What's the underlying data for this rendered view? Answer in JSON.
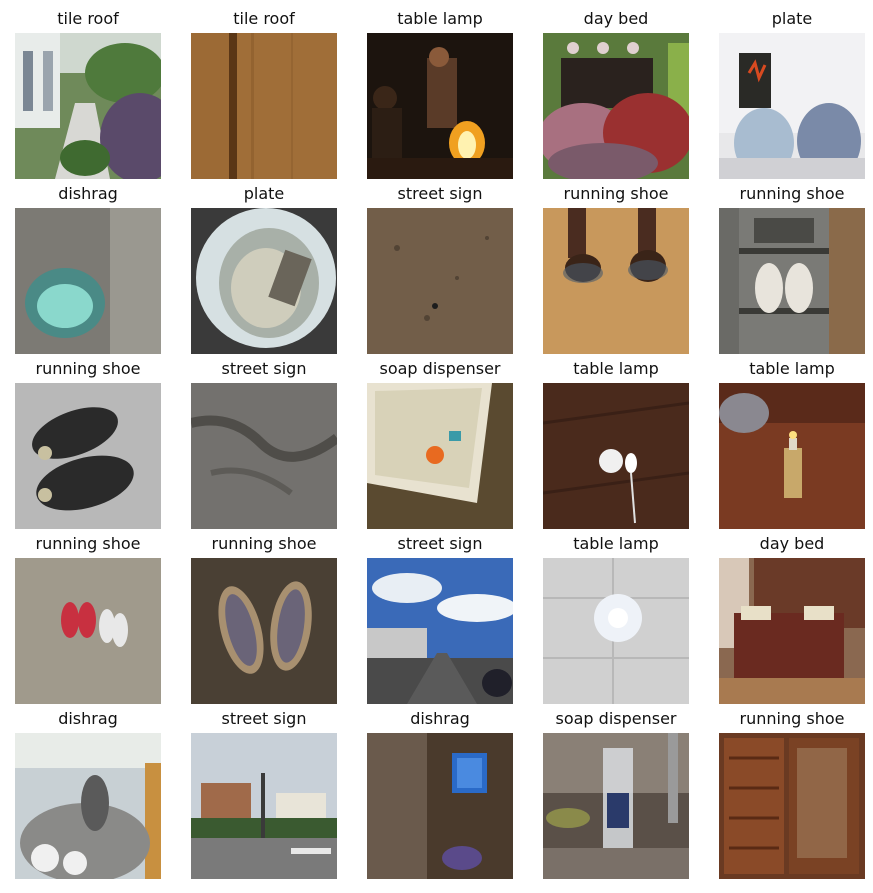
{
  "grid": {
    "rows": 5,
    "columns": 5,
    "items": [
      {
        "label": "tile roof",
        "scene": "garden"
      },
      {
        "label": "tile roof",
        "scene": "wood"
      },
      {
        "label": "table lamp",
        "scene": "fire"
      },
      {
        "label": "day bed",
        "scene": "messy-bed"
      },
      {
        "label": "plate",
        "scene": "plates"
      },
      {
        "label": "dishrag",
        "scene": "basin-cloth"
      },
      {
        "label": "plate",
        "scene": "bowl-food"
      },
      {
        "label": "street sign",
        "scene": "dirt"
      },
      {
        "label": "running shoe",
        "scene": "feet-sand"
      },
      {
        "label": "running shoe",
        "scene": "shoe-rack"
      },
      {
        "label": "running shoe",
        "scene": "sandals-dark"
      },
      {
        "label": "street sign",
        "scene": "asphalt"
      },
      {
        "label": "soap dispenser",
        "scene": "tray"
      },
      {
        "label": "table lamp",
        "scene": "ceiling-light"
      },
      {
        "label": "table lamp",
        "scene": "bottle-lamp"
      },
      {
        "label": "running shoe",
        "scene": "slippers-red"
      },
      {
        "label": "running shoe",
        "scene": "sandals-ground"
      },
      {
        "label": "street sign",
        "scene": "street-sky"
      },
      {
        "label": "table lamp",
        "scene": "wall-lamp"
      },
      {
        "label": "day bed",
        "scene": "bedroom"
      },
      {
        "label": "dishrag",
        "scene": "sink"
      },
      {
        "label": "street sign",
        "scene": "town-street"
      },
      {
        "label": "dishrag",
        "scene": "dark-room"
      },
      {
        "label": "soap dispenser",
        "scene": "faucet-bottle"
      },
      {
        "label": "running shoe",
        "scene": "wood-cabinet"
      }
    ]
  }
}
